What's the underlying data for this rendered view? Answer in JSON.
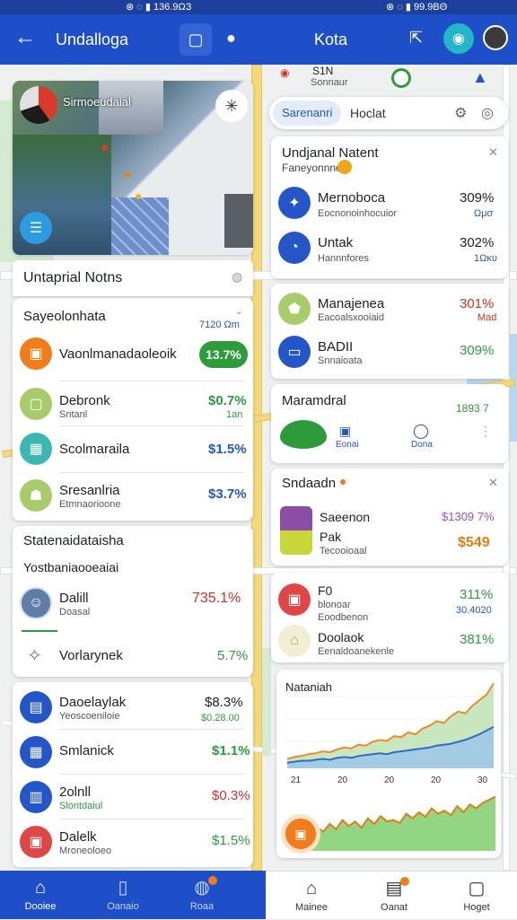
{
  "status": {
    "left": "⊗ ◌ ▮ 136.9ΩЗ",
    "right": "⊗ ◌ ▮ 99.9ΒΘ"
  },
  "appbar": {
    "left_title": "Undalloga",
    "right_title": "Kota"
  },
  "colors": {
    "appbar": "#1f4fc8",
    "green": "#2e9b3b",
    "red": "#d73027",
    "blue": "#2456c9",
    "orange": "#f07d1a"
  },
  "left": {
    "photo_card": {
      "caption": "Sirmoeudaial"
    },
    "notes_header": "Untaprial Notns",
    "list1": {
      "title": "Sayeolonhata",
      "count": "7120 Ωm",
      "items": [
        {
          "name": "Vaonlmanadaoleoik",
          "value": "13.7%",
          "icon": "camera-icon"
        },
        {
          "name": "Debronk",
          "sub": "Sntanl",
          "value": "$0.7%",
          "sub_value": "1an",
          "icon": "bag-icon"
        },
        {
          "name": "Scolmaraila",
          "value": "$1.5%",
          "icon": "grid-icon"
        },
        {
          "name": "Sresanlria",
          "sub": "Etmnaorioone",
          "value": "$3.7%",
          "icon": "people-icon"
        }
      ]
    },
    "list2": {
      "title": "Statenaidataisha",
      "subtitle": "Yostbaniaooeaiai",
      "items": [
        {
          "name": "Dalill",
          "sub": "Doasal",
          "value": "735.1%",
          "icon": "avatar"
        },
        {
          "name": "Vorlarynek",
          "value": "5.7%",
          "icon": "puzzle-icon"
        }
      ]
    },
    "list3": {
      "items": [
        {
          "name": "Daoelaylak",
          "sub": "Yeoscoeniloie",
          "value": "$8.3%",
          "sub_value": "$0.28.00",
          "icon": "calendar-icon"
        },
        {
          "name": "Smlanick",
          "value": "$1.1%",
          "icon": "table-icon"
        },
        {
          "name": "2olnll",
          "sub": "Slontdaiul",
          "value": "$0.3%",
          "icon": "chart-icon"
        },
        {
          "name": "Dalelk",
          "sub": "Mroneoloeo",
          "value": "$1.5%",
          "icon": "gift-icon"
        }
      ]
    },
    "nav": [
      {
        "label": "Dooiee",
        "icon": "home-icon"
      },
      {
        "label": "Oanaio",
        "icon": "doc-icon"
      },
      {
        "label": "Roaa",
        "icon": "location-icon"
      }
    ]
  },
  "right": {
    "chip": {
      "title": "S1N",
      "sub": "Sonnaur"
    },
    "search": {
      "placeholder": "Sarenanri",
      "value": "Hoclat"
    },
    "card1": {
      "title": "Undjanal Natent",
      "subtitle": "Faneyonnnel",
      "items": [
        {
          "name": "Mernoboca",
          "sub": "Eocnonoinhocuior",
          "value": "309%",
          "sub_value": "Ωμσ"
        },
        {
          "name": "Untak",
          "sub": "Hannnfores",
          "value": "302%",
          "sub_value": "1Ωκυ"
        }
      ]
    },
    "card2": {
      "items": [
        {
          "name": "Manajenea",
          "sub": "Eacoalsxooiaid",
          "value": "301%",
          "sub_value": "Mad"
        },
        {
          "name": "BADII",
          "sub": "Snnaioata",
          "value": "309%"
        }
      ]
    },
    "card3": {
      "title": "Maramdral",
      "value": "1893 7",
      "tiles": [
        "Eonai",
        "Dona"
      ]
    },
    "card4": {
      "title": "Sndaadn",
      "items": [
        {
          "name": "Saeenon",
          "value": "$1309 7%"
        },
        {
          "name": "Pak",
          "sub": "Tecooioaal",
          "value": "$549"
        }
      ]
    },
    "card5": {
      "items": [
        {
          "name": "F0",
          "sub1": "blonoar",
          "sub2": "Eoodbenon",
          "value": "311%",
          "sub_value": "30.4020"
        },
        {
          "name": "Doolaok",
          "sub": "Eenaldoanekenle",
          "value": "381%"
        }
      ]
    },
    "chart_card": {
      "title": "Nataniah"
    },
    "nav": [
      {
        "label": "Mainee",
        "icon": "home-icon"
      },
      {
        "label": "Oanat",
        "icon": "clipboard-icon"
      },
      {
        "label": "Hoget",
        "icon": "briefcase-icon"
      }
    ]
  },
  "chart_data": [
    {
      "type": "area",
      "title": "Nataniah",
      "x": [
        21,
        20,
        20,
        20,
        30
      ],
      "series": [
        {
          "values": [
            10,
            12,
            13,
            15,
            16,
            18,
            17,
            20,
            22,
            21,
            25,
            24,
            28,
            30,
            29,
            34,
            33,
            38,
            36,
            42,
            45,
            50,
            48,
            55,
            60,
            58,
            66,
            72,
            78,
            90
          ]
        },
        {
          "values": [
            6,
            7,
            8,
            8,
            9,
            10,
            9,
            11,
            12,
            11,
            13,
            14,
            15,
            16,
            15,
            17,
            18,
            19,
            20,
            21,
            22,
            24,
            25,
            26,
            28,
            30,
            33,
            36,
            40,
            44
          ]
        }
      ]
    },
    {
      "type": "area",
      "series": [
        {
          "values": [
            20,
            30,
            25,
            35,
            28,
            40,
            32,
            38,
            30,
            42,
            35,
            45,
            38,
            40,
            36,
            48,
            42,
            50,
            44,
            55,
            48,
            52,
            46,
            58,
            50,
            60,
            55,
            62,
            66,
            70
          ]
        }
      ]
    }
  ]
}
